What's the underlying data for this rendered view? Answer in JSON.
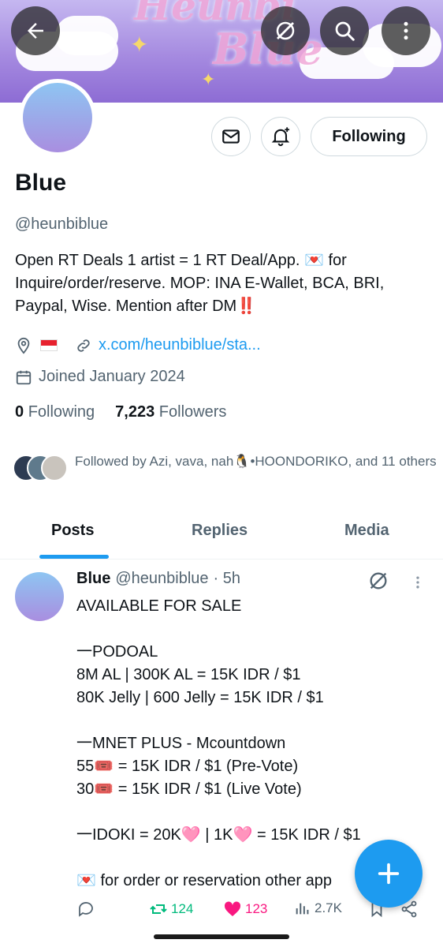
{
  "banner": {
    "text_top": "Heunbi",
    "text_bottom": "Blue"
  },
  "profile": {
    "name": "Blue",
    "handle": "@heunbiblue",
    "bio": "Open RT Deals 1 artist = 1 RT Deal/App. 💌 for Inquire/order/reserve. MOP: INA E-Wallet, BCA, BRI, Paypal, Wise. Mention after DM‼️",
    "link": "x.com/heunbiblue/sta...",
    "joined": "Joined January 2024",
    "following_count": "0",
    "following_label": "Following",
    "followers_count": "7,223",
    "followers_label": "Followers",
    "followed_by": "Followed by Azi, vava, nah🐧•HOONDORIKO, and 11 others"
  },
  "buttons": {
    "following": "Following"
  },
  "tabs": [
    "Posts",
    "Replies",
    "Media"
  ],
  "post": {
    "name": "Blue",
    "handle": "@heunbiblue",
    "time": "· 5h",
    "body": "AVAILABLE FOR SALE\n\n一PODOAL\n8M AL | 300K AL = 15K IDR / $1\n80K Jelly | 600 Jelly = 15K IDR / $1\n\n一MNET PLUS - Mcountdown\n55🎟️ = 15K IDR / $1 (Pre-Vote)\n30🎟️ = 15K IDR / $1 (Live Vote)\n\n一IDOKI = 20K🩷 | 1K🩷 = 15K IDR / $1\n\n💌 for order or reservation other app",
    "retweets": "124",
    "likes": "123",
    "views": "2.7K"
  },
  "colors": {
    "accent": "#1d9bf0",
    "retweet": "#00ba7c",
    "like": "#f91880",
    "secondary_text": "#536471"
  },
  "icons": [
    "back-arrow-icon",
    "grok-icon",
    "search-icon",
    "more-vertical-icon",
    "mail-icon",
    "bell-plus-icon",
    "location-icon",
    "flag-icon",
    "link-icon",
    "calendar-icon",
    "reply-icon",
    "retweet-icon",
    "heart-icon",
    "views-icon",
    "bookmark-icon",
    "share-icon",
    "plus-icon"
  ]
}
